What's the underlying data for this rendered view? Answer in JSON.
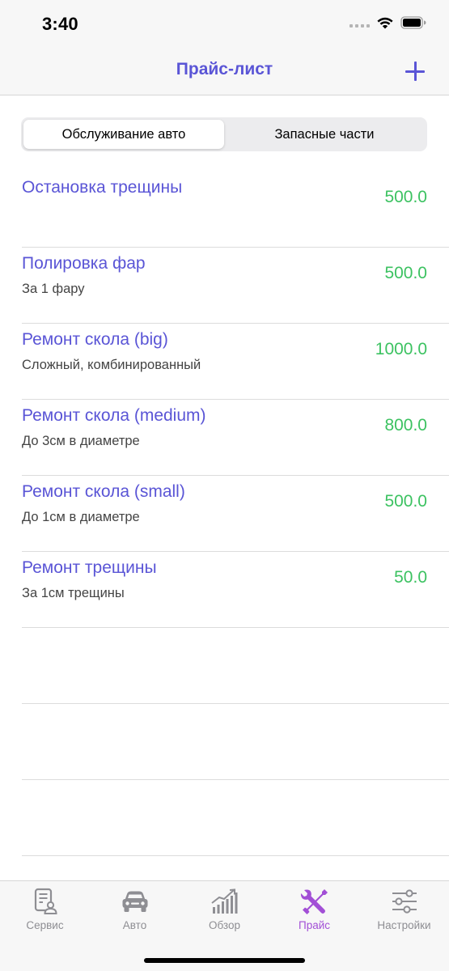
{
  "status_bar": {
    "time": "3:40"
  },
  "nav": {
    "title": "Прайс-лист"
  },
  "segments": [
    {
      "label": "Обслуживание авто",
      "active": true
    },
    {
      "label": "Запасные части",
      "active": false
    }
  ],
  "items": [
    {
      "title": "Остановка трещины",
      "subtitle": "",
      "price": "500.0"
    },
    {
      "title": "Полировка фар",
      "subtitle": "За 1 фару",
      "price": "500.0"
    },
    {
      "title": "Ремонт скола (big)",
      "subtitle": "Сложный, комбинированный",
      "price": "1000.0"
    },
    {
      "title": "Ремонт скола (medium)",
      "subtitle": "До 3см в диаметре",
      "price": "800.0"
    },
    {
      "title": "Ремонт скола (small)",
      "subtitle": "До 1см в диаметре",
      "price": "500.0"
    },
    {
      "title": "Ремонт трещины",
      "subtitle": "За 1см трещины",
      "price": "50.0"
    }
  ],
  "tabs": [
    {
      "label": "Сервис",
      "icon": "service-document-icon",
      "active": false
    },
    {
      "label": "Авто",
      "icon": "car-icon",
      "active": false
    },
    {
      "label": "Обзор",
      "icon": "chart-icon",
      "active": false
    },
    {
      "label": "Прайс",
      "icon": "tools-icon",
      "active": true
    },
    {
      "label": "Настройки",
      "icon": "sliders-icon",
      "active": false
    }
  ],
  "colors": {
    "accent": "#5a55d6",
    "price": "#3cc261",
    "tab_active": "#a24fd6",
    "tab_inactive": "#8e8e93"
  }
}
